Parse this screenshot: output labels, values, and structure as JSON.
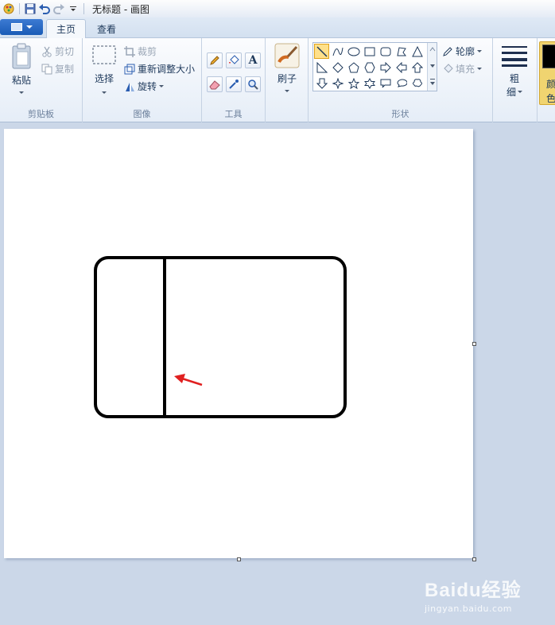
{
  "window": {
    "title": "无标题 - 画图"
  },
  "tabs": {
    "home": "主页",
    "view": "查看"
  },
  "clipboard": {
    "paste": "粘贴",
    "cut": "剪切",
    "copy": "复制",
    "label": "剪贴板"
  },
  "image": {
    "select": "选择",
    "crop": "裁剪",
    "resize": "重新调整大小",
    "rotate": "旋转",
    "label": "图像"
  },
  "tools": {
    "label": "工具",
    "text_glyph": "A"
  },
  "brushes": {
    "label": "刷子"
  },
  "shapes": {
    "label": "形状",
    "outline": "轮廓",
    "fill": "填充"
  },
  "size": {
    "label_top": "粗",
    "label_bottom": "细"
  },
  "color": {
    "label_top": "颜",
    "label_bottom": "色",
    "active_color": "#000000"
  },
  "watermark": {
    "main": "Baidu经验",
    "sub": "jingyan.baidu.com"
  },
  "colors": {
    "arrow": "#e02020",
    "stroke": "#000000"
  }
}
